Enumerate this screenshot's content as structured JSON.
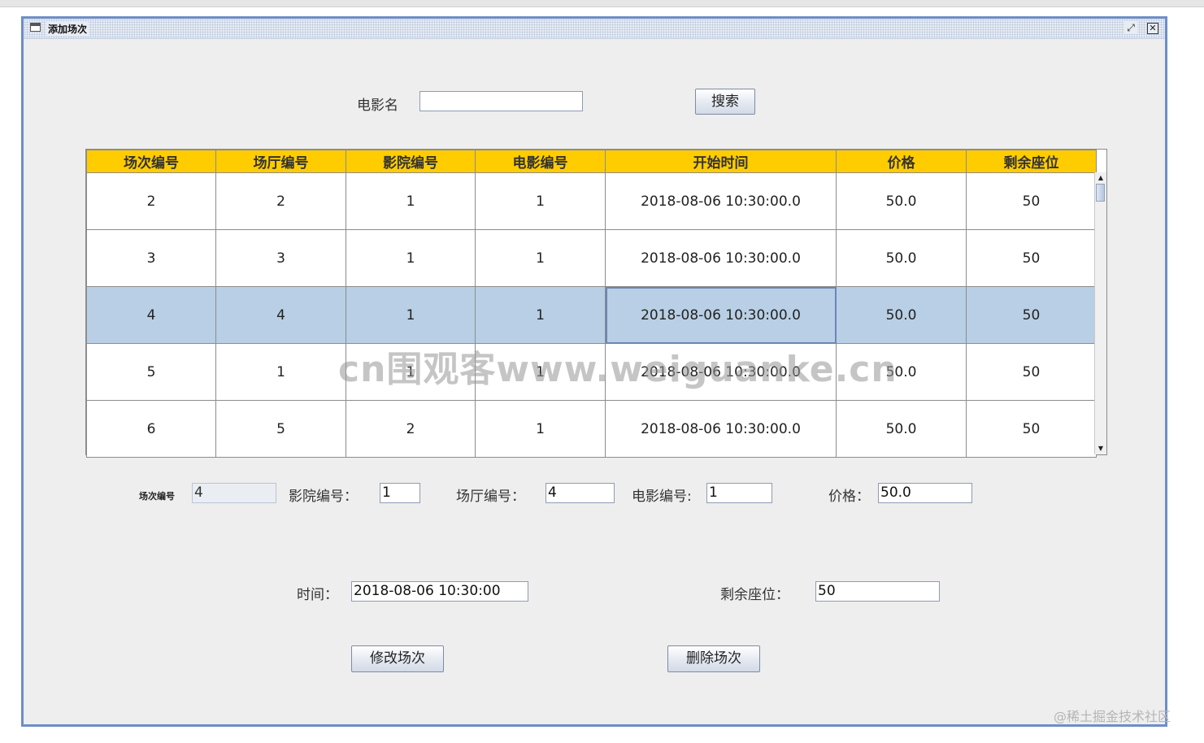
{
  "window": {
    "title": "添加场次",
    "restore_icon": "restore-icon",
    "close_icon": "close-icon",
    "close_glyph": "✕",
    "restore_glyph": "⤢"
  },
  "search": {
    "label": "电影名",
    "value": "",
    "button": "搜索"
  },
  "table": {
    "headers": [
      "场次编号",
      "场厅编号",
      "影院编号",
      "电影编号",
      "开始时间",
      "价格",
      "剩余座位"
    ],
    "rows": [
      [
        "2",
        "2",
        "1",
        "1",
        "2018-08-06 10:30:00.0",
        "50.0",
        "50"
      ],
      [
        "3",
        "3",
        "1",
        "1",
        "2018-08-06 10:30:00.0",
        "50.0",
        "50"
      ],
      [
        "4",
        "4",
        "1",
        "1",
        "2018-08-06 10:30:00.0",
        "50.0",
        "50"
      ],
      [
        "5",
        "1",
        "1",
        "1",
        "2018-08-06 10:30:00.0",
        "50.0",
        "50"
      ],
      [
        "6",
        "5",
        "2",
        "1",
        "2018-08-06 10:30:00.0",
        "50.0",
        "50"
      ]
    ],
    "selected_row_index": 2,
    "highlight_color": "#b8cfe5",
    "header_color": "#ffcc00"
  },
  "form": {
    "session_id_label": "场次编号",
    "session_id_value": "4",
    "cinema_label": "影院编号：",
    "cinema_value": "1",
    "hall_label": "场厅编号：",
    "hall_value": "4",
    "movie_label": "电影编号:",
    "movie_value": "1",
    "price_label": "价格：",
    "price_value": "50.0",
    "time_label": "时间：",
    "time_value": "2018-08-06 10:30:00",
    "seats_label": "剩余座位：",
    "seats_value": "50"
  },
  "actions": {
    "modify": "修改场次",
    "delete": "删除场次"
  },
  "overlay": {
    "watermark": "cn围观客www.weiguanke.cn",
    "credit": "@稀土掘金技术社区"
  }
}
